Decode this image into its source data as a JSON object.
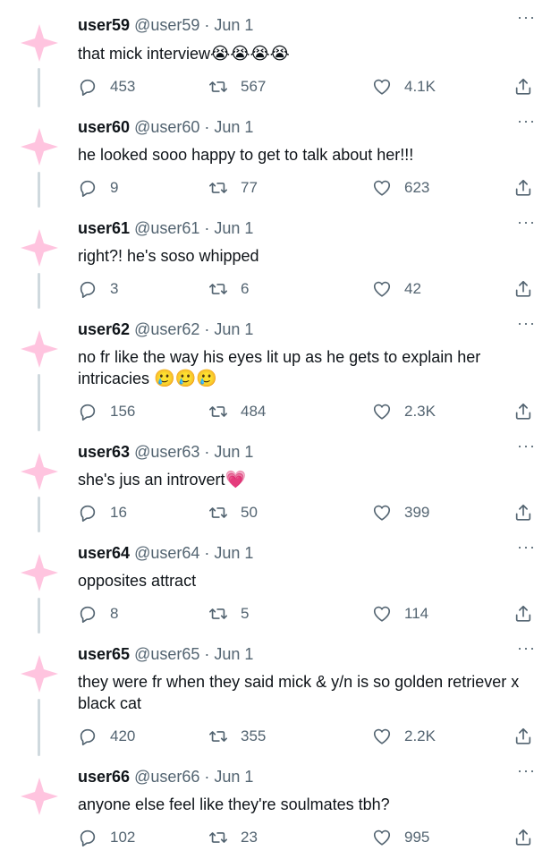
{
  "tweets": [
    {
      "name": "user59",
      "handle": "@user59",
      "date": "Jun 1",
      "text": "that mick interview",
      "emoji": "😭😭😭😭",
      "replies": "453",
      "retweets": "567",
      "likes": "4.1K"
    },
    {
      "name": "user60",
      "handle": "@user60",
      "date": "Jun 1",
      "text": "he looked sooo happy to get to talk about her!!!",
      "emoji": "",
      "replies": "9",
      "retweets": "77",
      "likes": "623"
    },
    {
      "name": "user61",
      "handle": "@user61",
      "date": "Jun 1",
      "text": "right?! he's soso whipped",
      "emoji": "",
      "replies": "3",
      "retweets": "6",
      "likes": "42"
    },
    {
      "name": "user62",
      "handle": "@user62",
      "date": "Jun 1",
      "text": "no fr like the way his eyes lit up as he gets to explain her intricacies",
      "emoji": "🥲🥲🥲",
      "replies": "156",
      "retweets": "484",
      "likes": "2.3K"
    },
    {
      "name": "user63",
      "handle": "@user63",
      "date": "Jun 1",
      "text": "she's jus an introvert",
      "emoji": "💗",
      "replies": "16",
      "retweets": "50",
      "likes": "399"
    },
    {
      "name": "user64",
      "handle": "@user64",
      "date": "Jun 1",
      "text": "opposites attract",
      "emoji": "",
      "replies": "8",
      "retweets": "5",
      "likes": "114"
    },
    {
      "name": "user65",
      "handle": "@user65",
      "date": "Jun 1",
      "text": "they were fr when they said mick & y/n is so golden retriever x black cat",
      "emoji": "",
      "replies": "420",
      "retweets": "355",
      "likes": "2.2K"
    },
    {
      "name": "user66",
      "handle": "@user66",
      "date": "Jun 1",
      "text": "anyone else feel like they're soulmates tbh?",
      "emoji": "",
      "replies": "102",
      "retweets": "23",
      "likes": "995"
    }
  ],
  "separator": "·",
  "more_glyph": "···",
  "colors": {
    "avatar_pink": "#ffc4df",
    "thread_line": "#cfd9de",
    "muted": "#536471"
  },
  "icons": {
    "reply": "reply-icon",
    "retweet": "retweet-icon",
    "like": "like-icon",
    "share": "share-icon",
    "avatar": "star-avatar"
  }
}
